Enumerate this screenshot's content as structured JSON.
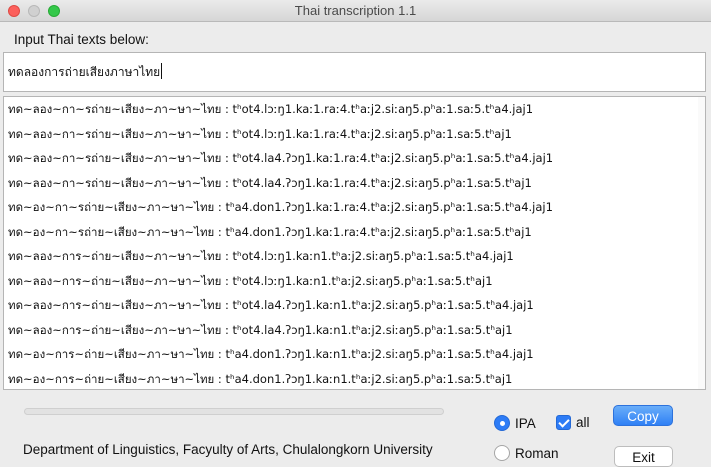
{
  "window": {
    "title": "Thai transcription 1.1"
  },
  "input": {
    "label": "Input Thai texts below:",
    "value": "ทดลองการถ่ายเสียงภาษาไทย"
  },
  "output": {
    "lines": [
      "ทด~ลอง~กา~รถ่าย~เสียง~ภา~ษา~ไทย : tʰot4.lɔːŋ1.kaː1.raː4.tʰaːj2.siːaŋ5.pʰaː1.saː5.tʰa4.jaj1",
      "ทด~ลอง~กา~รถ่าย~เสียง~ภา~ษา~ไทย : tʰot4.lɔːŋ1.kaː1.raː4.tʰaːj2.siːaŋ5.pʰaː1.saː5.tʰaj1",
      "ทด~ลอง~กา~รถ่าย~เสียง~ภา~ษา~ไทย : tʰot4.la4.ʔɔŋ1.kaː1.raː4.tʰaːj2.siːaŋ5.pʰaː1.saː5.tʰa4.jaj1",
      "ทด~ลอง~กา~รถ่าย~เสียง~ภา~ษา~ไทย : tʰot4.la4.ʔɔŋ1.kaː1.raː4.tʰaːj2.siːaŋ5.pʰaː1.saː5.tʰaj1",
      "ทด~อง~กา~รถ่าย~เสียง~ภา~ษา~ไทย : tʰa4.don1.ʔɔŋ1.kaː1.raː4.tʰaːj2.siːaŋ5.pʰaː1.saː5.tʰa4.jaj1",
      "ทด~อง~กา~รถ่าย~เสียง~ภา~ษา~ไทย : tʰa4.don1.ʔɔŋ1.kaː1.raː4.tʰaːj2.siːaŋ5.pʰaː1.saː5.tʰaj1",
      "ทด~ลอง~การ~ถ่าย~เสียง~ภา~ษา~ไทย : tʰot4.lɔːŋ1.kaːn1.tʰaːj2.siːaŋ5.pʰaː1.saː5.tʰa4.jaj1",
      "ทด~ลอง~การ~ถ่าย~เสียง~ภา~ษา~ไทย : tʰot4.lɔːŋ1.kaːn1.tʰaːj2.siːaŋ5.pʰaː1.saː5.tʰaj1",
      "ทด~ลอง~การ~ถ่าย~เสียง~ภา~ษา~ไทย : tʰot4.la4.ʔɔŋ1.kaːn1.tʰaːj2.siːaŋ5.pʰaː1.saː5.tʰa4.jaj1",
      "ทด~ลอง~การ~ถ่าย~เสียง~ภา~ษา~ไทย : tʰot4.la4.ʔɔŋ1.kaːn1.tʰaːj2.siːaŋ5.pʰaː1.saː5.tʰaj1",
      "ทด~อง~การ~ถ่าย~เสียง~ภา~ษา~ไทย : tʰa4.don1.ʔɔŋ1.kaːn1.tʰaːj2.siːaŋ5.pʰaː1.saː5.tʰa4.jaj1",
      "ทด~อง~การ~ถ่าย~เสียง~ภา~ษา~ไทย : tʰa4.don1.ʔɔŋ1.kaːn1.tʰaːj2.siːaŋ5.pʰaː1.saː5.tʰaj1"
    ]
  },
  "progress": {
    "value": 0
  },
  "options": {
    "ipa_label": "IPA",
    "roman_label": "Roman",
    "all_label": "all",
    "selected": "IPA",
    "all_checked": true
  },
  "buttons": {
    "copy": "Copy",
    "exit": "Exit"
  },
  "footer": {
    "text": "Department of Linguistics, Facyulty of Arts, Chulalongkorn University"
  },
  "colors": {
    "accent": "#2d7cf6",
    "close": "#fc605c",
    "maximize": "#34c84a"
  },
  "icons": {
    "close": "close-icon",
    "minimize": "minimize-icon",
    "maximize": "maximize-icon",
    "checkmark": "checkmark-icon"
  }
}
